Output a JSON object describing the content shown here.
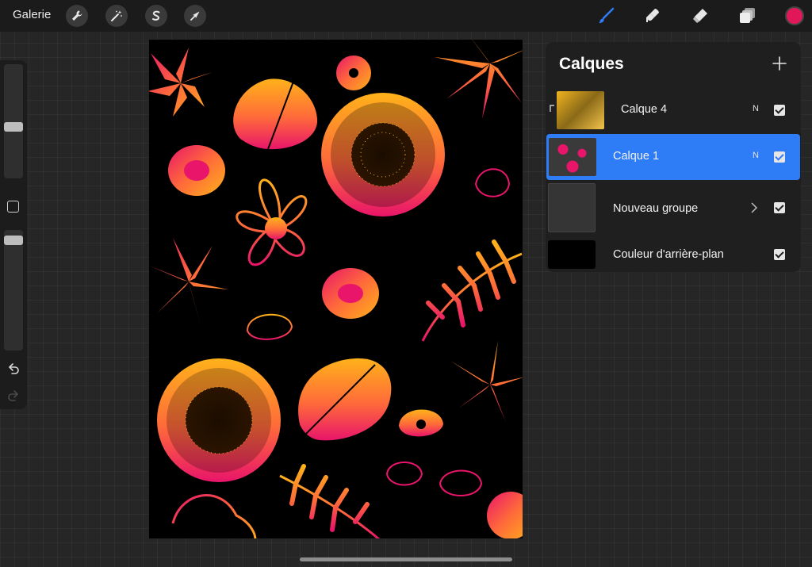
{
  "topbar": {
    "gallery_label": "Galerie",
    "tools_left": [
      "wrench-icon",
      "magic-wand-icon",
      "selection-s-icon",
      "transform-arrow-icon"
    ],
    "tools_right": [
      "brush-icon",
      "smudge-icon",
      "eraser-icon",
      "layers-icon"
    ],
    "active_color": "#e0185a",
    "accent": "#2f7df6"
  },
  "sidebar": {
    "brush_size": 0.45,
    "opacity": 0.05
  },
  "layers_panel": {
    "title": "Calques",
    "add_label": "+",
    "layers": [
      {
        "name": "Calque 4",
        "blend": "N",
        "visible": true,
        "clipped": true,
        "selected": false
      },
      {
        "name": "Calque 1",
        "blend": "N",
        "visible": true,
        "clipped": false,
        "selected": true
      },
      {
        "name": "Nouveau groupe",
        "blend": "",
        "visible": true,
        "group": true,
        "selected": false
      },
      {
        "name": "Couleur d'arrière-plan",
        "blend": "",
        "visible": true,
        "selected": false,
        "color": "#000000"
      }
    ]
  },
  "colors": {
    "gradient_start": "#ffb21a",
    "gradient_mid": "#ff6a3a",
    "gradient_end": "#e8156a",
    "canvas_bg": "#000000"
  }
}
